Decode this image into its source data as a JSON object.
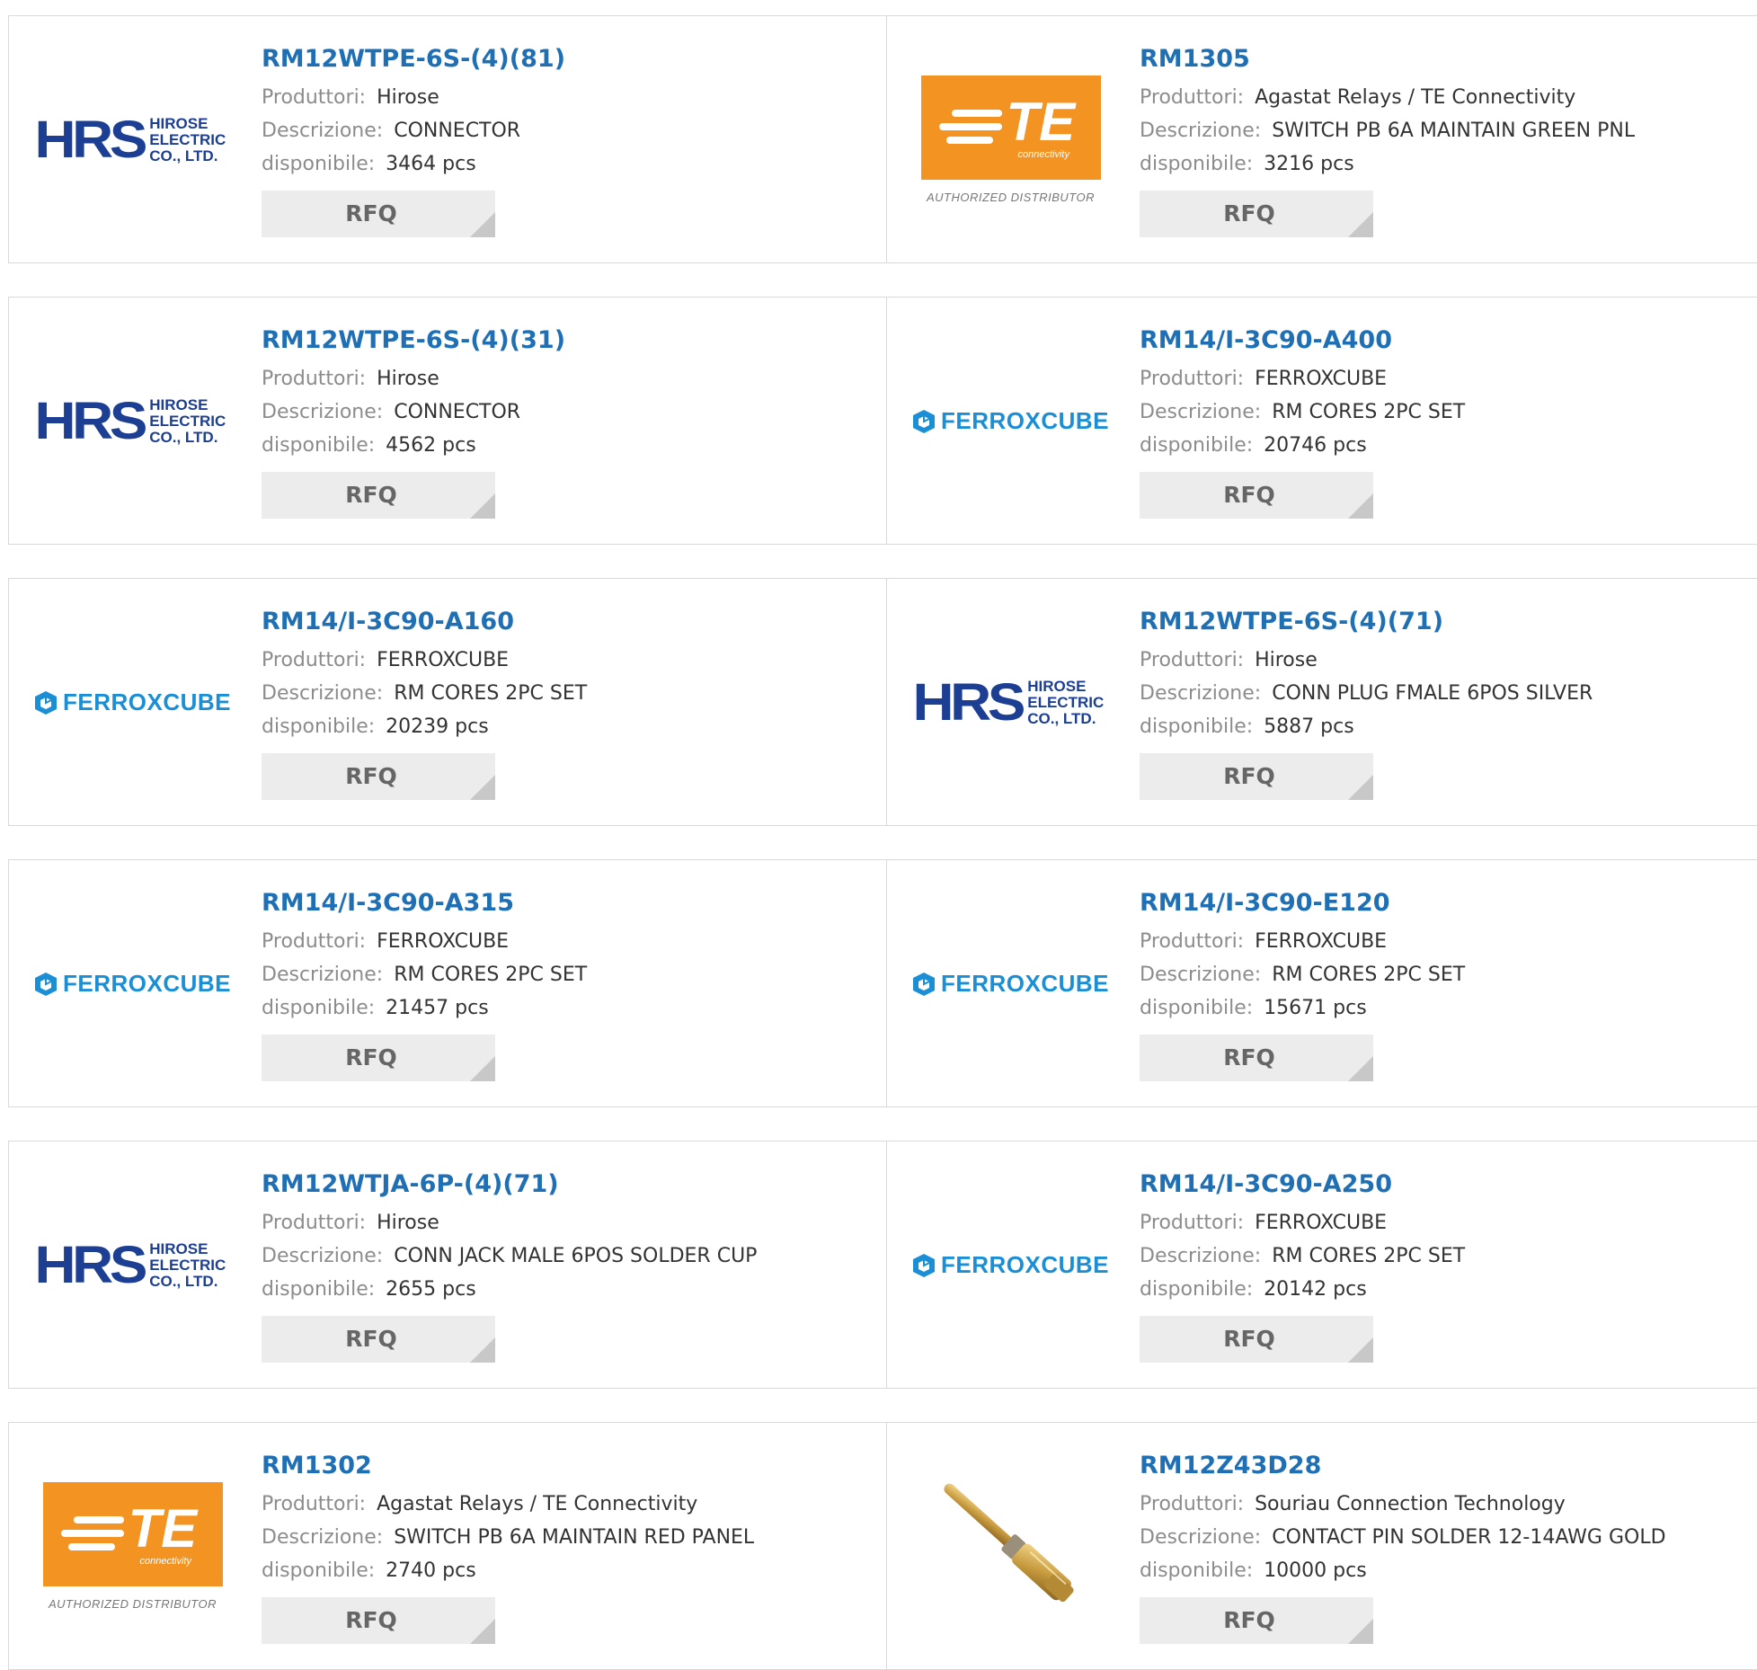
{
  "labels": {
    "producer": "Produttori:",
    "description": "Descrizione:",
    "availability": "disponibile:",
    "rfq": "RFQ"
  },
  "logos": {
    "hirose": {
      "mark": "HRS",
      "line1": "HIROSE",
      "line2": "ELECTRIC",
      "line3": "CO., LTD."
    },
    "ferroxcube": {
      "text": "FERROXCUBE"
    },
    "te": {
      "letters": "TE",
      "sub": "connectivity",
      "authorized": "AUTHORIZED DISTRIBUTOR"
    }
  },
  "products": [
    {
      "part": "RM12WTPE-6S-(4)(81)",
      "logo": "hirose",
      "producer": "Hirose",
      "description": "CONNECTOR",
      "availability": "3464 pcs"
    },
    {
      "part": "RM1305",
      "logo": "te",
      "producer": "Agastat Relays / TE Connectivity",
      "description": "SWITCH PB 6A MAINTAIN GREEN PNL",
      "availability": "3216 pcs"
    },
    {
      "part": "RM12WTPE-6S-(4)(31)",
      "logo": "hirose",
      "producer": "Hirose",
      "description": "CONNECTOR",
      "availability": "4562 pcs"
    },
    {
      "part": "RM14/I-3C90-A400",
      "logo": "ferroxcube",
      "producer": "FERROXCUBE",
      "description": "RM CORES 2PC SET",
      "availability": "20746 pcs"
    },
    {
      "part": "RM14/I-3C90-A160",
      "logo": "ferroxcube",
      "producer": "FERROXCUBE",
      "description": "RM CORES 2PC SET",
      "availability": "20239 pcs"
    },
    {
      "part": "RM12WTPE-6S-(4)(71)",
      "logo": "hirose",
      "producer": "Hirose",
      "description": "CONN PLUG FMALE 6POS SILVER",
      "availability": "5887 pcs"
    },
    {
      "part": "RM14/I-3C90-A315",
      "logo": "ferroxcube",
      "producer": "FERROXCUBE",
      "description": "RM CORES 2PC SET",
      "availability": "21457 pcs"
    },
    {
      "part": "RM14/I-3C90-E120",
      "logo": "ferroxcube",
      "producer": "FERROXCUBE",
      "description": "RM CORES 2PC SET",
      "availability": "15671 pcs"
    },
    {
      "part": "RM12WTJA-6P-(4)(71)",
      "logo": "hirose",
      "producer": "Hirose",
      "description": "CONN JACK MALE 6POS SOLDER CUP",
      "availability": "2655 pcs"
    },
    {
      "part": "RM14/I-3C90-A250",
      "logo": "ferroxcube",
      "producer": "FERROXCUBE",
      "description": "RM CORES 2PC SET",
      "availability": "20142 pcs"
    },
    {
      "part": "RM1302",
      "logo": "te",
      "producer": "Agastat Relays / TE Connectivity",
      "description": "SWITCH PB 6A MAINTAIN RED PANEL",
      "availability": "2740 pcs"
    },
    {
      "part": "RM12Z43D28",
      "logo": "pin-photo",
      "producer": "Souriau Connection Technology",
      "description": "CONTACT PIN SOLDER 12-14AWG GOLD",
      "availability": "10000 pcs"
    }
  ],
  "colors": {
    "part_link": "#1f6fb5",
    "hirose_blue": "#1c3f94",
    "ferroxcube_blue": "#1a8fd6",
    "te_orange": "#f39321",
    "rfq_bg": "#ececec"
  }
}
